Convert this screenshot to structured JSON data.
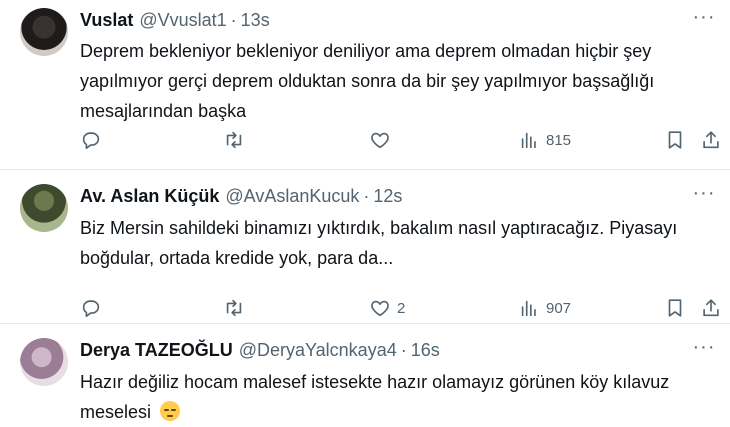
{
  "tweets": [
    {
      "name": "Vuslat",
      "handle": "@Vvuslat1",
      "separator": "·",
      "time": "13s",
      "text": "Deprem bekleniyor bekleniyor deniliyor ama deprem olmadan hiçbir şey yapılmıyor gerçi deprem olduktan sonra da bir şey yapılmıyor başsağlığı mesajlarından başka",
      "likes": "",
      "views": "815"
    },
    {
      "name": "Av. Aslan Küçük",
      "handle": "@AvAslanKucuk",
      "separator": "·",
      "time": "12s",
      "text": "Biz Mersin sahildeki binamızı yıktırdık, bakalım nasıl yaptıracağız. Piyasayı boğdular, ortada kredide yok, para da...",
      "likes": "2",
      "views": "907"
    },
    {
      "name": "Derya TAZEOĞLU",
      "handle": "@DeryaYalcnkaya4",
      "separator": "·",
      "time": "16s",
      "text": "Hazır değiliz hocam malesef istesekte hazır olamayız görünen köy kılavuz meselesi",
      "emoji": "pensive-face-emoji"
    }
  ],
  "more_glyph": "···",
  "colors": {
    "text": "#0f1419",
    "secondary": "#536471",
    "divider": "#e7e9ea"
  }
}
